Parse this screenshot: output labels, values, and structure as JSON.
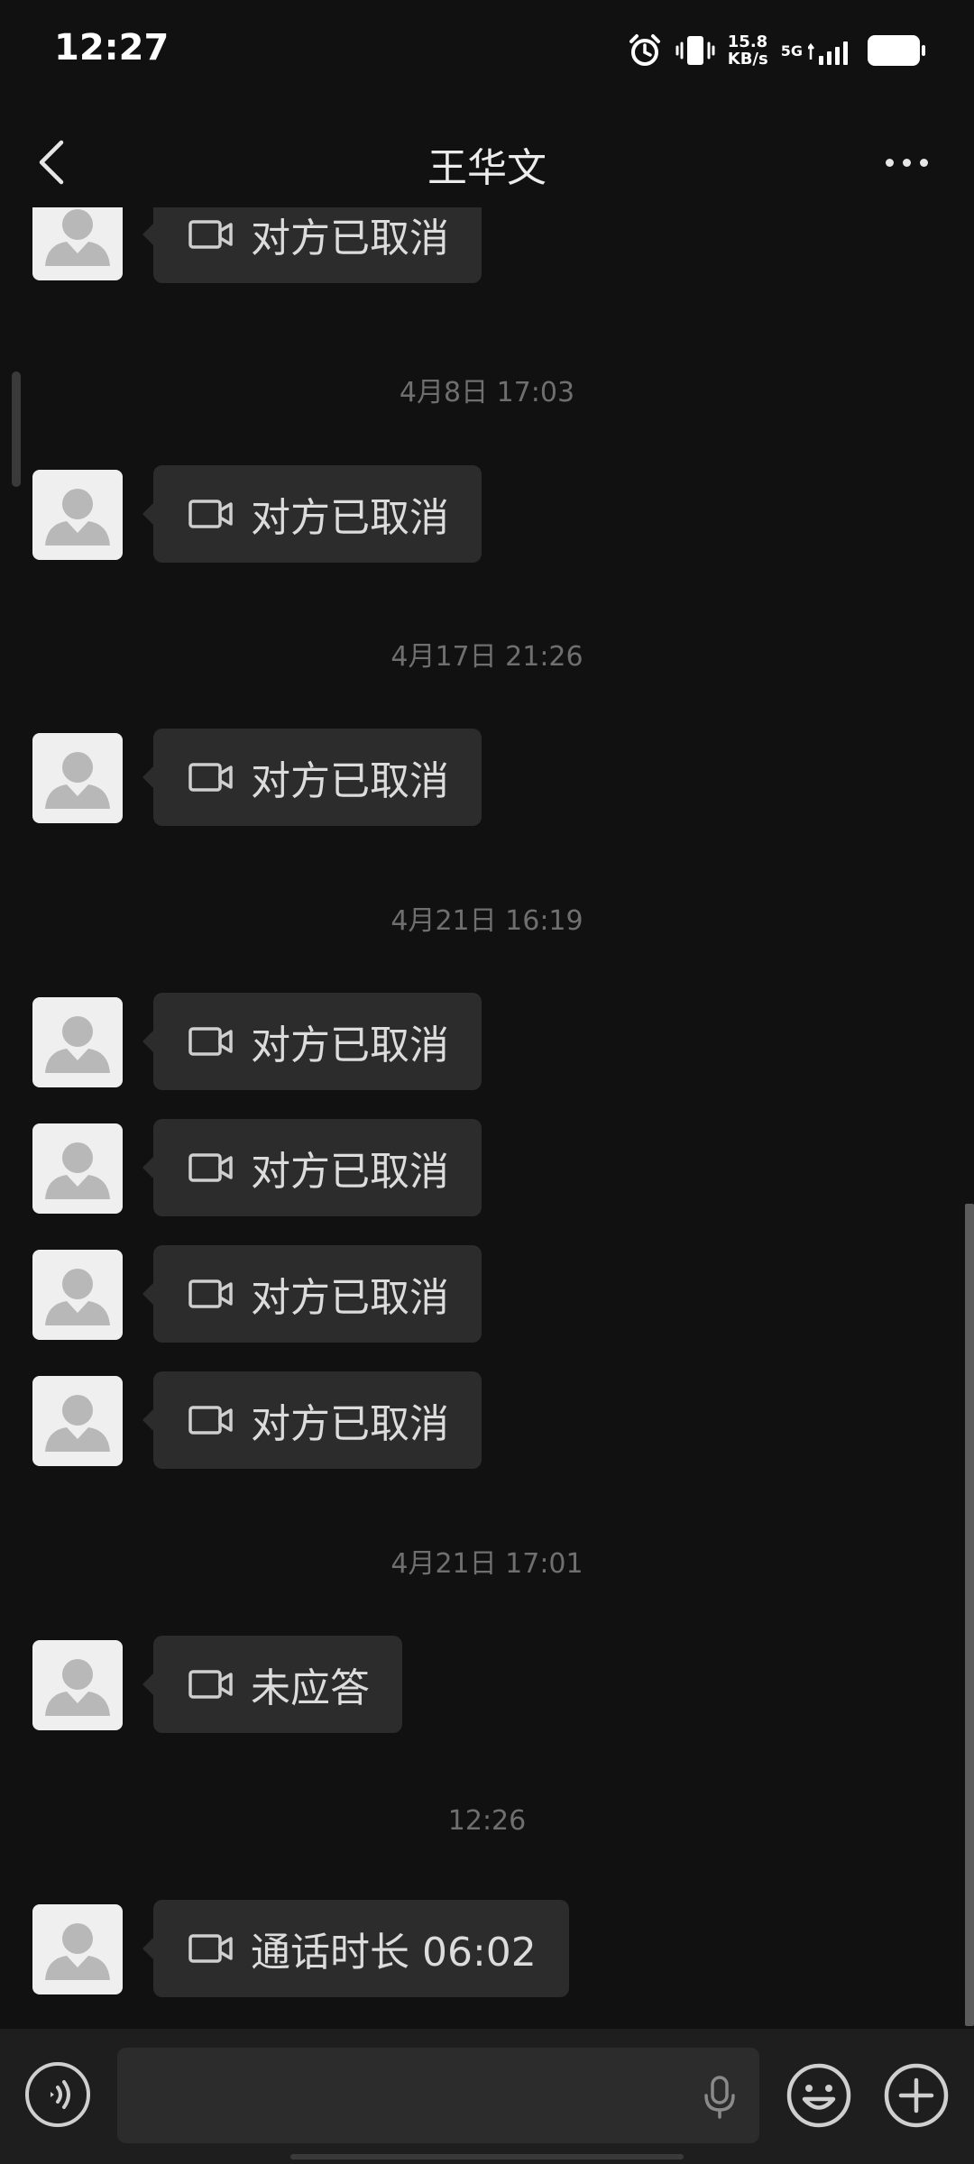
{
  "status_bar": {
    "time": "12:27",
    "net_speed_value": "15.8",
    "net_speed_unit": "KB/s",
    "network_type": "5G"
  },
  "header": {
    "title": "王华文"
  },
  "messages": [
    {
      "type": "call",
      "text": "对方已取消"
    },
    {
      "type": "timestamp",
      "text": "4月8日 17:03"
    },
    {
      "type": "call",
      "text": "对方已取消"
    },
    {
      "type": "timestamp",
      "text": "4月17日 21:26"
    },
    {
      "type": "call",
      "text": "对方已取消"
    },
    {
      "type": "timestamp",
      "text": "4月21日 16:19"
    },
    {
      "type": "call",
      "text": "对方已取消"
    },
    {
      "type": "call",
      "text": "对方已取消"
    },
    {
      "type": "call",
      "text": "对方已取消"
    },
    {
      "type": "call",
      "text": "对方已取消"
    },
    {
      "type": "timestamp",
      "text": "4月21日 17:01"
    },
    {
      "type": "call",
      "text": "未应答"
    },
    {
      "type": "timestamp",
      "text": "12:26"
    },
    {
      "type": "call",
      "text": "通话时长 06:02"
    }
  ],
  "icons": {
    "back": "chevron-left-icon",
    "more": "more-dots-icon",
    "call": "video-camera-icon",
    "voice": "voice-mode-icon",
    "mic": "microphone-icon",
    "emoji": "emoji-icon",
    "plus": "plus-icon"
  },
  "colors": {
    "background": "#111111",
    "bubble": "#2c2c2c",
    "bottom_bar": "#1e1e1e",
    "timestamp_text": "#6f6f6f"
  }
}
